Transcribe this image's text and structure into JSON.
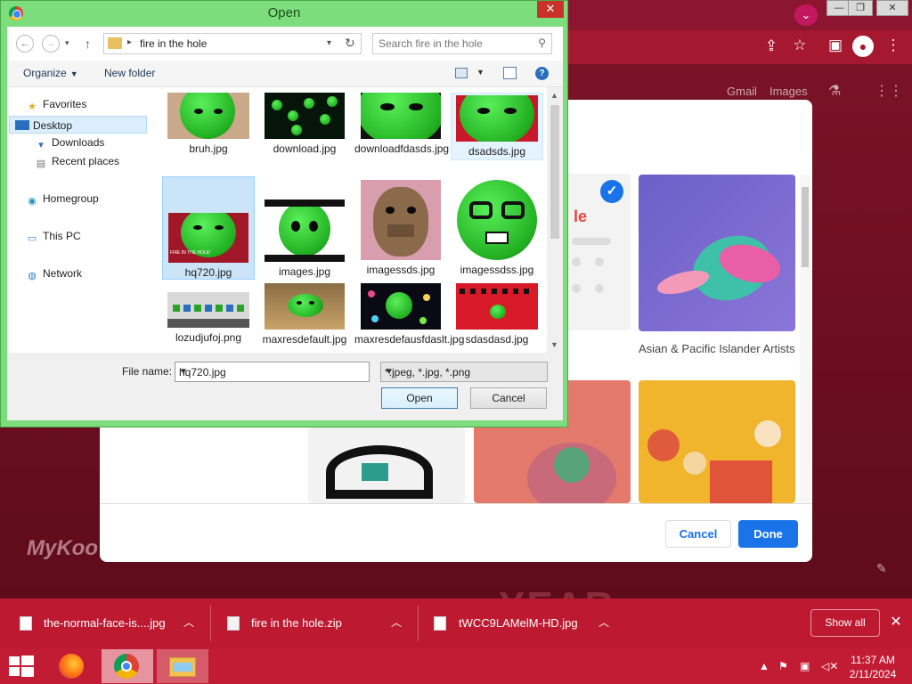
{
  "dialog": {
    "title": "Open",
    "address_path": "fire in the hole",
    "search_placeholder": "Search fire in the hole",
    "organize_label": "Organize",
    "new_folder_label": "New folder",
    "nav": {
      "favorites": "Favorites",
      "desktop": "Desktop",
      "downloads": "Downloads",
      "recent_places": "Recent places",
      "homegroup": "Homegroup",
      "this_pc": "This PC",
      "network": "Network"
    },
    "files": [
      {
        "name": "bruh.jpg"
      },
      {
        "name": "download.jpg"
      },
      {
        "name": "downloadfdasds.jpg"
      },
      {
        "name": "dsadsds.jpg"
      },
      {
        "name": "hq720.jpg",
        "thumb_text": "FIRE IN THE HOLE!"
      },
      {
        "name": "images.jpg"
      },
      {
        "name": "imagessds.jpg"
      },
      {
        "name": "imagessdss.jpg"
      },
      {
        "name": "lozudjufoj.png"
      },
      {
        "name": "maxresdefault.jpg"
      },
      {
        "name": "maxresdefausfdaslt.jpg"
      },
      {
        "name": "sdasdasd.jpg"
      }
    ],
    "selected_file": "hq720.jpg",
    "file_name_label": "File name:",
    "file_name_value": "hq720.jpg",
    "file_type_value": "*.jpeg, *.jpg, *.png",
    "open_label": "Open",
    "cancel_label": "Cancel"
  },
  "background": {
    "google_links": [
      "Gmail",
      "Images"
    ],
    "tile_label": "Asian & Pacific Islander Artists",
    "tile_letter": "le",
    "cancel_label": "Cancel",
    "done_label": "Done",
    "bg_text": "MyKoo",
    "bg_big_text": "YEAR"
  },
  "downloads": {
    "items": [
      {
        "name": "the-normal-face-is....jpg"
      },
      {
        "name": "fire in the hole.zip"
      },
      {
        "name": "tWCC9LAMelM-HD.jpg"
      }
    ],
    "show_all": "Show all"
  },
  "taskbar": {
    "time": "11:37 AM",
    "date": "2/11/2024"
  },
  "colors": {
    "chrome_theme": "#a5182f",
    "dialog_frame": "#7ddc7c",
    "accent_blue": "#1a73e8",
    "taskbar": "#c21c35"
  }
}
